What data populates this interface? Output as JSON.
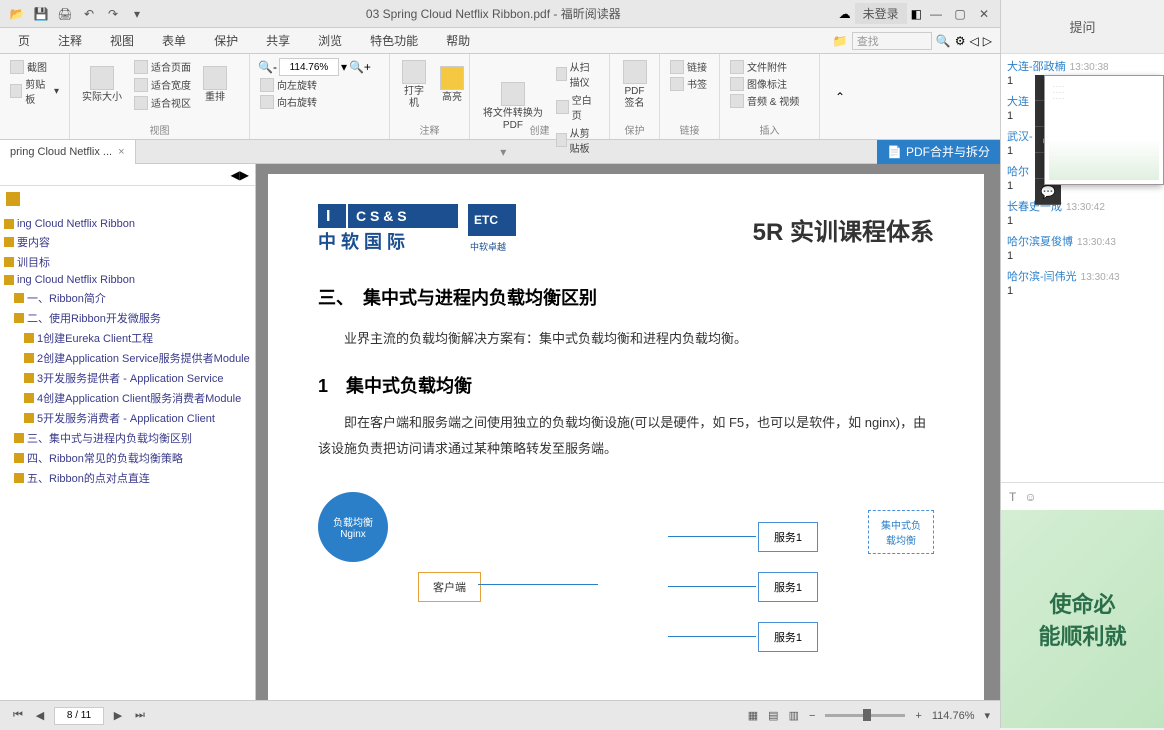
{
  "titlebar": {
    "title": "03 Spring Cloud Netflix Ribbon.pdf - 福昕阅读器",
    "login": "未登录"
  },
  "menu": {
    "items": [
      "页",
      "注释",
      "视图",
      "表单",
      "保护",
      "共享",
      "浏览",
      "特色功能",
      "帮助"
    ],
    "search_placeholder": "查找"
  },
  "ribbon": {
    "screenshot": "截图",
    "clipboard": "剪贴板",
    "actual_size": "实际大小",
    "fit_page": "适合页面",
    "fit_width": "适合宽度",
    "fit_view": "适合视区",
    "reflow": "重排",
    "zoom_value": "114.76%",
    "rotate_left": "向左旋转",
    "rotate_right": "向右旋转",
    "group_view": "视图",
    "typewriter": "打字机",
    "highlight": "高亮",
    "group_annot": "注释",
    "convert_pdf": "将文件转换为PDF",
    "from_scanner": "从扫描仪",
    "blank_page": "空白页",
    "from_clipboard": "从剪贴板",
    "group_create": "创建",
    "pdf_sign": "PDF签名",
    "group_protect": "保护",
    "link": "链接",
    "bookmark": "书签",
    "group_link": "链接",
    "file_attach": "文件附件",
    "image_annot": "图像标注",
    "audio_video": "音频 & 视频",
    "group_insert": "插入",
    "merge_split_label": "PDF合并与拆分"
  },
  "tab": {
    "name": "pring Cloud Netflix ..."
  },
  "bookmarks": [
    {
      "text": "ing Cloud Netflix Ribbon",
      "level": 1
    },
    {
      "text": "要内容",
      "level": 1
    },
    {
      "text": "训目标",
      "level": 1
    },
    {
      "text": "ing Cloud Netflix Ribbon",
      "level": 1
    },
    {
      "text": "一、Ribbon简介",
      "level": 2
    },
    {
      "text": "二、使用Ribbon开发微服务",
      "level": 2
    },
    {
      "text": "1创建Eureka Client工程",
      "level": 3
    },
    {
      "text": "2创建Application Service服务提供者Module",
      "level": 3
    },
    {
      "text": "3开发服务提供者 - Application Service",
      "level": 3
    },
    {
      "text": "4创建Application Client服务消费者Module",
      "level": 3
    },
    {
      "text": "5开发服务消费者 - Application Client",
      "level": 3
    },
    {
      "text": "三、集中式与进程内负载均衡区别",
      "level": 2
    },
    {
      "text": "四、Ribbon常见的负载均衡策略",
      "level": 2
    },
    {
      "text": "五、Ribbon的点对点直连",
      "level": 2
    }
  ],
  "page": {
    "brand_subtitle": "5R 实训课程体系",
    "h2": "三、　集中式与进程内负载均衡区别",
    "p1": "业界主流的负载均衡解决方案有：集中式负载均衡和进程内负载均衡。",
    "h3": "1　集中式负载均衡",
    "p2": "即在客户端和服务端之间使用独立的负载均衡设施(可以是硬件，如 F5，也可以是软件，如 nginx)，由该设施负责把访问请求通过某种策略转发至服务端。",
    "diagram": {
      "client": "客户端",
      "lb": "负载均衡",
      "lb2": "Nginx",
      "service": "服务1",
      "note": "集中式负载均衡"
    }
  },
  "status": {
    "page": "8 / 11",
    "zoom": "114.76%"
  },
  "chat": {
    "tab_label": "提问",
    "items": [
      {
        "name": "大连-邵政楠",
        "time": "13:30:38",
        "msg": "1"
      },
      {
        "name": "大连",
        "time": "",
        "msg": "1"
      },
      {
        "name": "武汉-",
        "time": "",
        "msg": "1"
      },
      {
        "name": "哈尔",
        "time": "",
        "msg": "1"
      },
      {
        "name": "长春史一成",
        "time": "13:30:42",
        "msg": "1"
      },
      {
        "name": "哈尔滨夏俊博",
        "time": "13:30:43",
        "msg": "1"
      },
      {
        "name": "哈尔滨-闫伟光",
        "time": "13:30:43",
        "msg": "1"
      }
    ]
  },
  "ad": {
    "line1": "使命必",
    "line2": "能顺利就"
  }
}
